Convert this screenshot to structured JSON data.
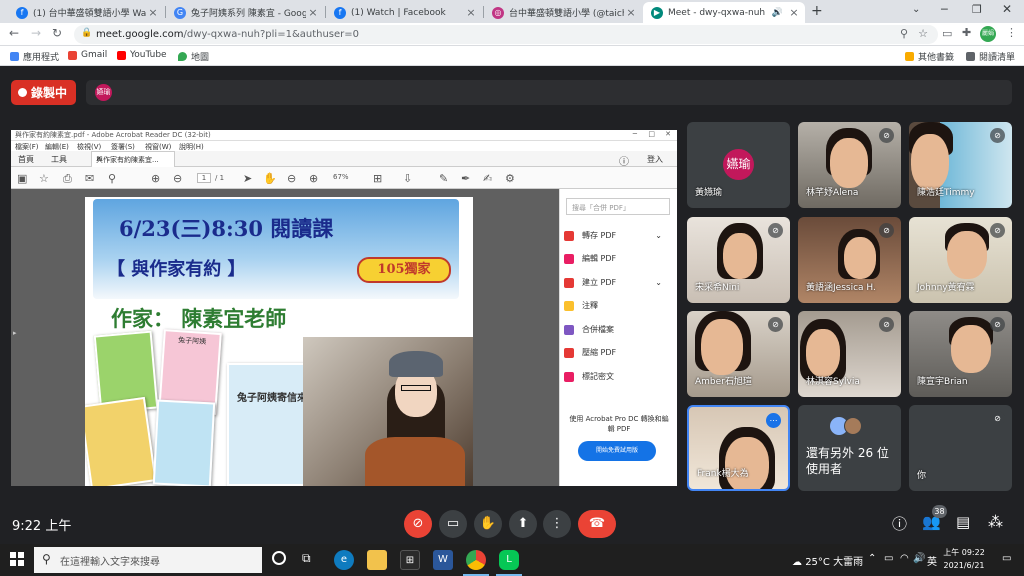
{
  "browser": {
    "tabs": [
      {
        "title": "(1) 台中華盛頓雙語小學 Washin",
        "icon": "facebook-icon",
        "color": "#1877f2"
      },
      {
        "title": "兔子阿姨系列 陳素宜 - Google 搜",
        "icon": "google-icon",
        "color": "#4285f4"
      },
      {
        "title": "(1) Watch | Facebook",
        "icon": "facebook-icon",
        "color": "#1877f2"
      },
      {
        "title": "台中華盛頓雙語小學 (@taichun",
        "icon": "instagram-icon",
        "color": "#c13584"
      },
      {
        "title": "Meet - dwy-qxwa-nuh",
        "icon": "meet-icon",
        "color": "#00897b"
      }
    ],
    "new_tab": "+",
    "url_host": "meet.google.com",
    "url_rest": "/dwy-qxwa-nuh?pli=1&authuser=0",
    "profile": "麗娟",
    "bookmarks": [
      {
        "label": "應用程式",
        "color": "#4285f4"
      },
      {
        "label": "Gmail",
        "color": "#ea4335"
      },
      {
        "label": "YouTube",
        "color": "#ff0000"
      },
      {
        "label": "地圖",
        "color": "#34a853"
      }
    ],
    "bookmarks_right": [
      {
        "label": "其他書籤"
      },
      {
        "label": "閱讀清單"
      }
    ]
  },
  "meet": {
    "record_label": "錄製中",
    "presenter_avatar": "嬿瑜",
    "acrobat": {
      "title": "與作家有約陳素宜.pdf - Adobe Acrobat Reader DC (32-bit)",
      "menu": [
        "檔案(F)",
        "編輯(E)",
        "檢視(V)",
        "簽署(S)",
        "視窗(W)",
        "說明(H)"
      ],
      "tabs": [
        "首頁",
        "工具"
      ],
      "doc_tab": "與作家有約陳素宜...",
      "login": "登入",
      "page_current": "1",
      "page_total": "/ 1",
      "zoom": "67%",
      "search_placeholder": "搜尋「合併 PDF」",
      "tools": [
        {
          "label": "轉存 PDF",
          "color": "#e53935"
        },
        {
          "label": "編輯 PDF",
          "color": "#e91e63"
        },
        {
          "label": "建立 PDF",
          "color": "#e53935"
        },
        {
          "label": "注釋",
          "color": "#fbc02d"
        },
        {
          "label": "合併檔案",
          "color": "#7e57c2"
        },
        {
          "label": "壓縮 PDF",
          "color": "#e53935"
        },
        {
          "label": "標記密文",
          "color": "#e91e63"
        }
      ],
      "pro_text": "使用 Acrobat Pro DC 轉換和編輯 PDF",
      "try_btn": "開始免費試用版"
    },
    "poster": {
      "line1": "6/23(三)8:30 閱讀課",
      "line2": "【 與作家有約 】",
      "badge": "105獨家",
      "line3": "作家：  陳素宜老師",
      "book1": "兔子阿姨",
      "book2": "兔子阿姨寄信來"
    },
    "participants": [
      {
        "name": "黃嬿瑜",
        "avatar": "嬿瑜",
        "muted": false
      },
      {
        "name": "林芊妤Alena",
        "muted": true
      },
      {
        "name": "陳浩廷Timmy",
        "muted": true
      },
      {
        "name": "宋采希Nini",
        "muted": true
      },
      {
        "name": "黃語涵Jessica H.",
        "muted": true
      },
      {
        "name": "Johnny黃宥霖",
        "muted": true
      },
      {
        "name": "Amber石旭瑄",
        "muted": true
      },
      {
        "name": "林淇容Sylvia",
        "muted": true
      },
      {
        "name": "陳宣宇Brian",
        "muted": true
      },
      {
        "name": "Frank楊大為",
        "muted": false
      },
      {
        "name": "",
        "more": "還有另外 26 位使用者"
      },
      {
        "name": "你",
        "muted": true
      }
    ],
    "clock": "9:22 上午",
    "people_count": "38"
  },
  "taskbar": {
    "search_placeholder": "在這裡輸入文字來搜尋",
    "weather": "25°C 大雷雨",
    "lang": "英",
    "time": "上午 09:22",
    "date": "2021/6/21"
  }
}
